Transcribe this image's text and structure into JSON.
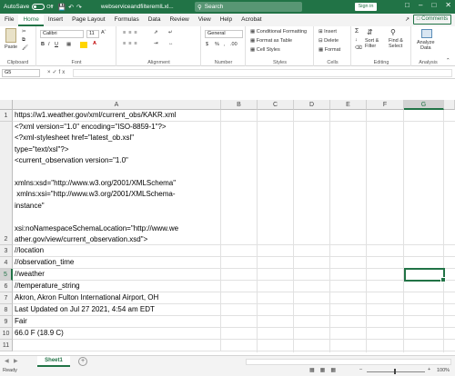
{
  "title_bar": {
    "autosave_label": "AutoSave",
    "autosave_state": "Off",
    "file_name": "webserviceandfilteremlLxl...",
    "search_placeholder": "Search",
    "sign_in_label": "Sign in"
  },
  "ribbon_tabs": [
    "File",
    "Home",
    "Insert",
    "Page Layout",
    "Formulas",
    "Data",
    "Review",
    "View",
    "Help",
    "Acrobat"
  ],
  "active_tab": "Home",
  "share_label": "",
  "comments_label": "Comments",
  "ribbon": {
    "clipboard": {
      "paste": "Paste",
      "label": "Clipboard"
    },
    "font": {
      "name": "Calibri",
      "size": "11",
      "label": "Font"
    },
    "alignment": {
      "label": "Alignment"
    },
    "number": {
      "format": "General",
      "label": "Number"
    },
    "styles": {
      "conditional": "Conditional Formatting",
      "format_table": "Format as Table",
      "cell_styles": "Cell Styles",
      "label": "Styles"
    },
    "cells": {
      "insert": "Insert",
      "delete": "Delete",
      "format": "Format",
      "label": "Cells"
    },
    "editing": {
      "sort": "Sort &",
      "filter": "Filter",
      "find": "Find &",
      "select": "Select",
      "label": "Editing"
    },
    "analysis": {
      "analyze": "Analyze",
      "data": "Data",
      "label": "Analysis"
    }
  },
  "formula_bar": {
    "name_box": "G5",
    "fx": "fx",
    "value": ""
  },
  "columns": [
    "A",
    "B",
    "C",
    "D",
    "E",
    "F",
    "G"
  ],
  "selected_column": "G",
  "rows": [
    {
      "num": "1",
      "a": "https://w1.weather.gov/xml/current_obs/KAKR.xml"
    },
    {
      "num": "2",
      "a": "<?xml version=\"1.0\" encoding=\"ISO-8859-1\"?>\n<?xml-stylesheet href=\"latest_ob.xsl\"\ntype=\"text/xsl\"?>\n<current_observation version=\"1.0\"\n\nxmlns:xsd=\"http://www.w3.org/2001/XMLSchema\"\n xmlns:xsi=\"http://www.w3.org/2001/XMLSchema-\ninstance\"\n\nxsi:noNamespaceSchemaLocation=\"http://www.we\nather.gov/view/current_observation.xsd\">"
    },
    {
      "num": "3",
      "a": "//location"
    },
    {
      "num": "4",
      "a": "//observation_time"
    },
    {
      "num": "5",
      "a": "//weather"
    },
    {
      "num": "6",
      "a": "//temperature_string"
    },
    {
      "num": "7",
      "a": "Akron, Akron Fulton International Airport, OH"
    },
    {
      "num": "8",
      "a": "Last Updated on Jul 27 2021, 4:54 am EDT"
    },
    {
      "num": "9",
      "a": "Fair"
    },
    {
      "num": "10",
      "a": "66.0 F (18.9 C)"
    },
    {
      "num": "11",
      "a": ""
    }
  ],
  "selected_row": "5",
  "sheet_tab": "Sheet1",
  "status": {
    "ready": "Ready",
    "zoom": "100%"
  },
  "colors": {
    "accent": "#217346"
  }
}
